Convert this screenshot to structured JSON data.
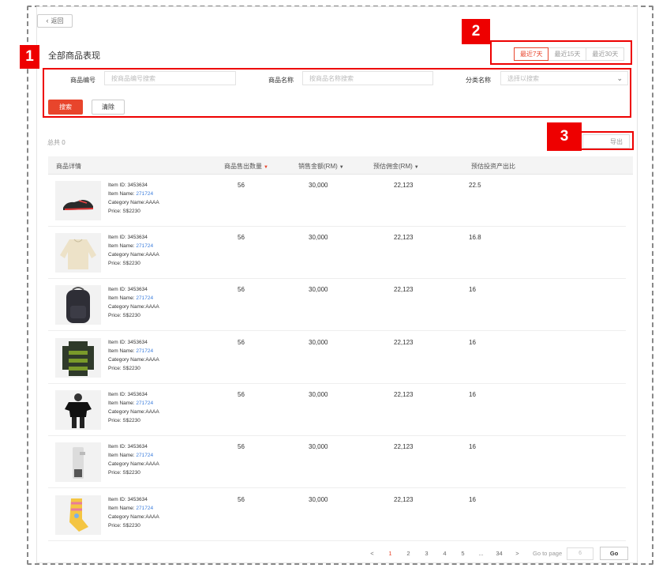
{
  "back_label": "返回",
  "page_title": "全部商品表现",
  "date_tabs": [
    "最近7天",
    "最近15天",
    "最近30天"
  ],
  "active_tab": 0,
  "filters": {
    "product_code_label": "商品编号",
    "product_code_placeholder": "按商品编号搜索",
    "product_name_label": "商品名称",
    "product_name_placeholder": "按商品名称搜索",
    "category_label": "分类名称",
    "category_placeholder": "选择以搜索"
  },
  "buttons": {
    "search": "搜索",
    "clear": "清除",
    "export": "导出"
  },
  "total_label": "总共 0",
  "annotations": [
    "1",
    "2",
    "3"
  ],
  "table": {
    "headers": [
      "商品详情",
      "商品售出数量",
      "销售金额(RM)",
      "预估佣金(RM)",
      "预估投资产出比"
    ],
    "rows": [
      {
        "image": "shoe",
        "id": "Item ID: 3453634",
        "name_prefix": "Item Name: ",
        "name": "271724",
        "category": "Category Name:AAAA",
        "price": "Price: S$2230",
        "qty": "56",
        "sales": "30,000",
        "commission": "22,123",
        "roi": "22.5"
      },
      {
        "image": "sweater",
        "id": "Item ID: 3453634",
        "name_prefix": "Item Name: ",
        "name": "271724",
        "category": "Category Name:AAAA",
        "price": "Price: S$2230",
        "qty": "56",
        "sales": "30,000",
        "commission": "22,123",
        "roi": "16.8"
      },
      {
        "image": "backpack",
        "id": "Item ID: 3453634",
        "name_prefix": "Item Name: ",
        "name": "271724",
        "category": "Category Name:AAAA",
        "price": "Price: S$2230",
        "qty": "56",
        "sales": "30,000",
        "commission": "22,123",
        "roi": "16"
      },
      {
        "image": "striped-sweater",
        "id": "Item ID: 3453634",
        "name_prefix": "Item Name: ",
        "name": "271724",
        "category": "Category Name:AAAA",
        "price": "Price: S$2230",
        "qty": "56",
        "sales": "30,000",
        "commission": "22,123",
        "roi": "16"
      },
      {
        "image": "person-tshirt",
        "id": "Item ID: 3453634",
        "name_prefix": "Item Name: ",
        "name": "271724",
        "category": "Category Name:AAAA",
        "price": "Price: S$2230",
        "qty": "56",
        "sales": "30,000",
        "commission": "22,123",
        "roi": "16"
      },
      {
        "image": "dispenser",
        "id": "Item ID: 3453634",
        "name_prefix": "Item Name: ",
        "name": "271724",
        "category": "Category Name:AAAA",
        "price": "Price: S$2230",
        "qty": "56",
        "sales": "30,000",
        "commission": "22,123",
        "roi": "16"
      },
      {
        "image": "socks",
        "id": "Item ID: 3453634",
        "name_prefix": "Item Name: ",
        "name": "271724",
        "category": "Category Name:AAAA",
        "price": "Price: S$2230",
        "qty": "56",
        "sales": "30,000",
        "commission": "22,123",
        "roi": "16"
      }
    ]
  },
  "pagination": {
    "prev": "<",
    "pages": [
      "1",
      "2",
      "3",
      "4",
      "5",
      "...",
      "34"
    ],
    "next": ">",
    "active_page": "1",
    "goto_label": "Go to page",
    "goto_value": "6",
    "go_label": "Go"
  },
  "colors": {
    "accent": "#e8452c",
    "annotation": "#e00000",
    "link": "#3b7ddd"
  }
}
